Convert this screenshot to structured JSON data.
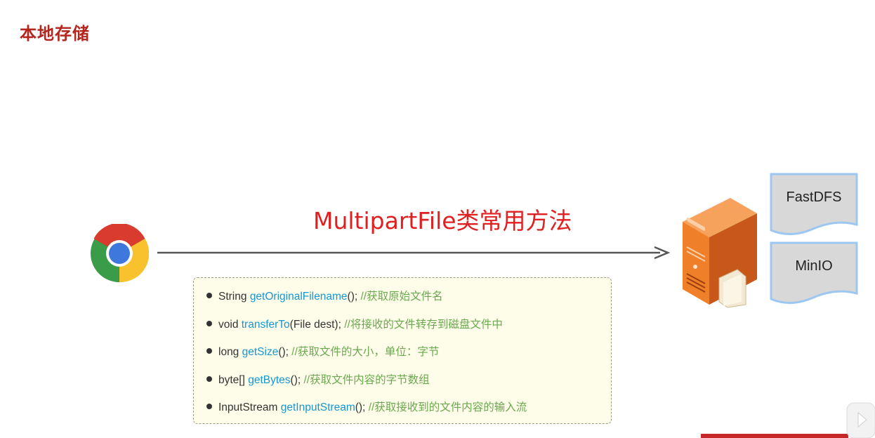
{
  "page": {
    "title": "本地存储"
  },
  "headline": "MultipartFile类常用方法",
  "storage": {
    "fastdfs": "FastDFS",
    "minio": "MinIO"
  },
  "methods": [
    {
      "type": "String",
      "name": "getOriginalFilename",
      "suffix": "();",
      "comment": "//获取原始文件名"
    },
    {
      "type": "void",
      "name": "transferTo",
      "suffix": "(File dest);",
      "comment": "//将接收的文件转存到磁盘文件中"
    },
    {
      "type": "long",
      "name": "getSize",
      "suffix": "();",
      "comment": "//获取文件的大小，单位：字节"
    },
    {
      "type": "byte[]",
      "name": "getBytes",
      "suffix": "();",
      "comment": "//获取文件内容的字节数组"
    },
    {
      "type": "InputStream",
      "name": "getInputStream",
      "suffix": "();",
      "comment": "//获取接收到的文件内容的输入流"
    }
  ],
  "colors": {
    "title": "#b3261e",
    "headline": "#e02020",
    "method_name": "#1796d2",
    "comment": "#6aa84f",
    "box_bg": "#fefde9",
    "server": "#f07f2a",
    "card": "#d8d8d8"
  },
  "icons": [
    "chrome-icon",
    "server-icon",
    "folder-icon",
    "arrow-icon"
  ]
}
